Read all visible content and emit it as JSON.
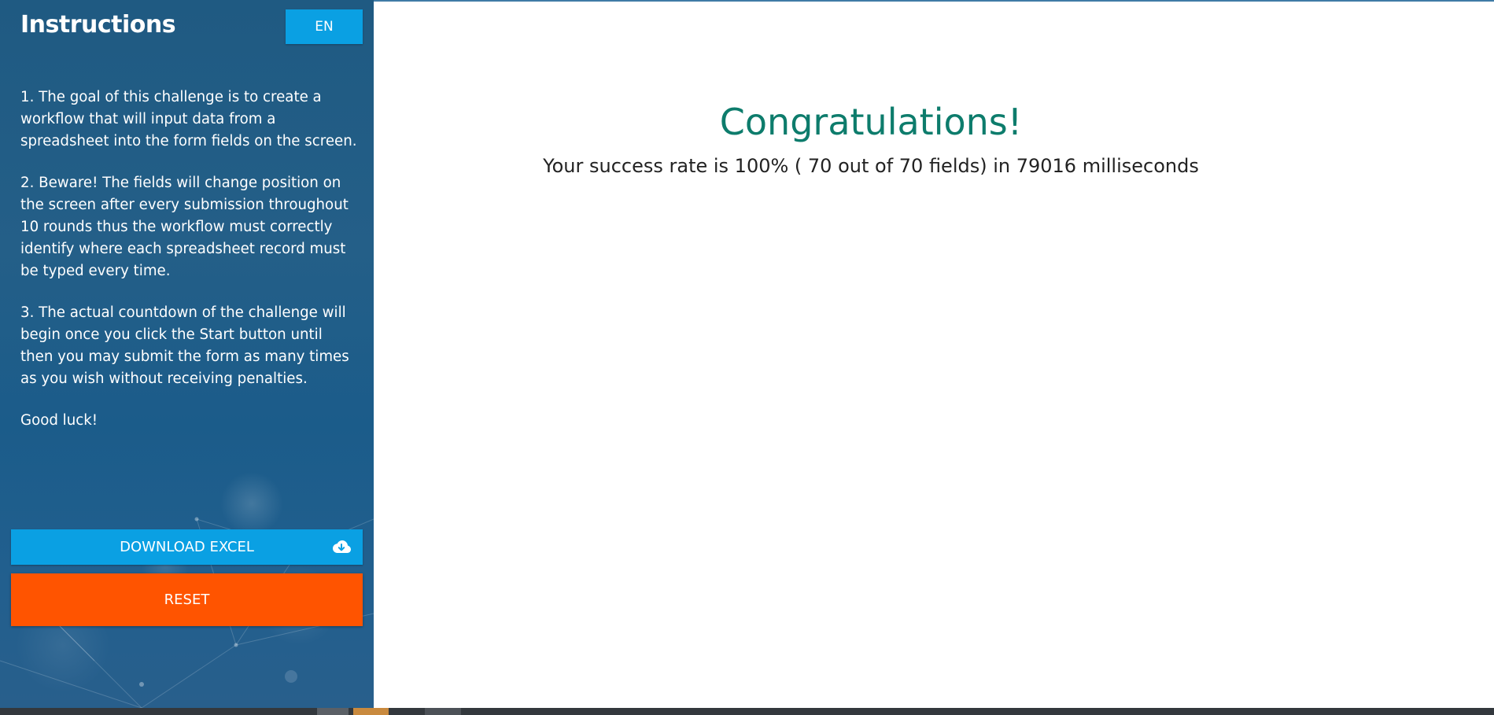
{
  "sidebar": {
    "title": "Instructions",
    "language_button": "EN",
    "instructions": [
      "1. The goal of this challenge is to create a workflow that will input data from a spreadsheet into the form fields on the screen.",
      "2. Beware! The fields will change position on the screen after every submission throughout 10 rounds thus the workflow must correctly identify where each spreadsheet record must be typed every time.",
      "3. The actual countdown of the challenge will begin once you click the Start button until then you may submit the form as many times as you wish without receiving penalties.",
      "Good luck!"
    ],
    "download_button": "DOWNLOAD EXCEL",
    "download_icon": "cloud-download-icon",
    "reset_button": "RESET"
  },
  "main": {
    "heading": "Congratulations!",
    "result": "Your success rate is 100% ( 70 out of 70 fields) in 79016 milliseconds"
  },
  "colors": {
    "sidebar_bg": "#1f5a82",
    "accent_blue": "#0aa0e3",
    "reset_orange": "#ff5400",
    "heading_teal": "#0d7c6c"
  }
}
